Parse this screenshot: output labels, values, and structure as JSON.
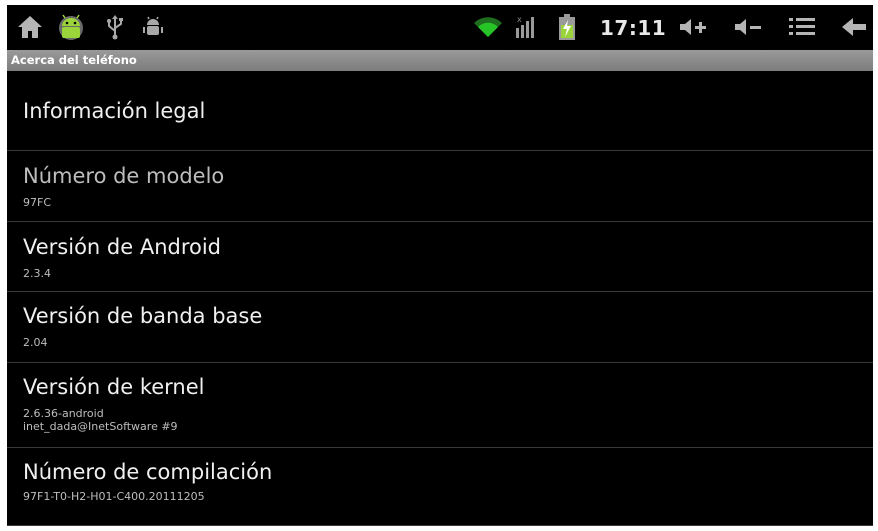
{
  "status_bar": {
    "left_icons": [
      "home-icon",
      "android-robot-icon",
      "usb-icon",
      "debug-bug-icon"
    ],
    "right_icons": [
      "wifi-icon",
      "signal-icon",
      "battery-charging-icon",
      "volume-up-icon",
      "volume-down-icon",
      "menu-icon",
      "back-icon"
    ],
    "time": "17:11"
  },
  "title_bar": {
    "title": "Acerca del teléfono"
  },
  "items": [
    {
      "title": "Información legal",
      "subs": []
    },
    {
      "title": "Número de modelo",
      "subs": [
        "97FC"
      ]
    },
    {
      "title": "Versión de Android",
      "subs": [
        "2.3.4"
      ]
    },
    {
      "title": "Versión de banda base",
      "subs": [
        "2.04"
      ]
    },
    {
      "title": "Versión de kernel",
      "subs": [
        "2.6.36-android",
        "inet_dada@InetSoftware #9"
      ]
    },
    {
      "title": "Número de compilación",
      "subs": [
        "97F1-T0-H2-H01-C400.20111205"
      ]
    }
  ],
  "colors": {
    "background": "#000000",
    "title_bar": "#8a8a8a",
    "text": "#f0f0f0",
    "subtext": "#bdbdbd",
    "wifi": "#27c427",
    "battery": "#9bd43a"
  }
}
